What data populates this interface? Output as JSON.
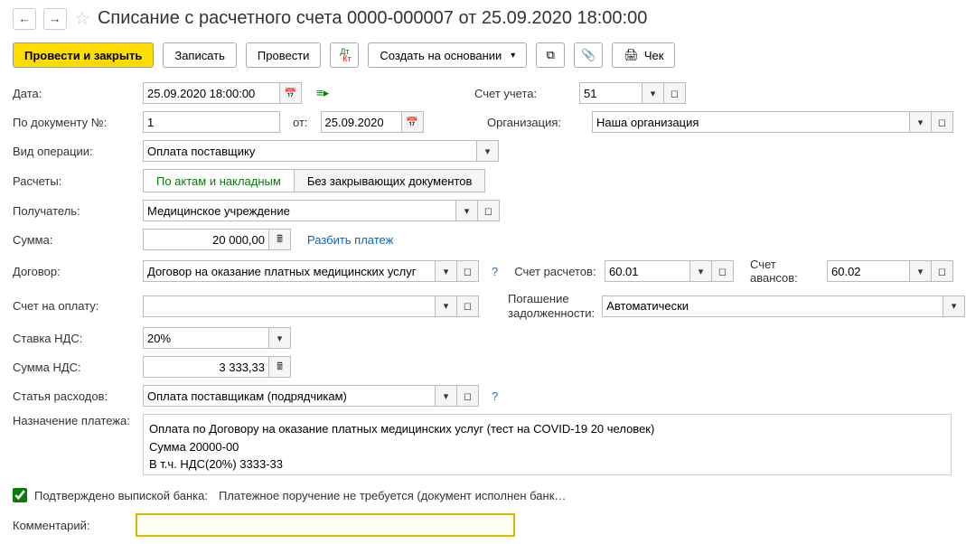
{
  "header": {
    "title": "Списание с расчетного счета 0000-000007 от 25.09.2020 18:00:00"
  },
  "toolbar": {
    "post_and_close": "Провести и закрыть",
    "write": "Записать",
    "post": "Провести",
    "create_based_on": "Создать на основании",
    "check": "Чек"
  },
  "fields": {
    "date_lbl": "Дата:",
    "date_val": "25.09.2020 18:00:00",
    "doc_num_lbl": "По документу №:",
    "doc_num_val": "1",
    "from_lbl": "от:",
    "from_val": "25.09.2020",
    "op_type_lbl": "Вид операции:",
    "op_type_val": "Оплата поставщику",
    "calc_lbl": "Расчеты:",
    "tab_acts": "По актам и накладным",
    "tab_nodocs": "Без закрывающих документов",
    "recipient_lbl": "Получатель:",
    "recipient_val": "Медицинское учреждение",
    "sum_lbl": "Сумма:",
    "sum_val": "20 000,00",
    "split_payment": "Разбить платеж",
    "contract_lbl": "Договор:",
    "contract_val": "Договор на оказание платных медицинских услуг",
    "invoice_lbl": "Счет на оплату:",
    "invoice_val": "",
    "vat_rate_lbl": "Ставка НДС:",
    "vat_rate_val": "20%",
    "vat_sum_lbl": "Сумма НДС:",
    "vat_sum_val": "3 333,33",
    "expense_lbl": "Статья расходов:",
    "expense_val": "Оплата поставщикам (подрядчикам)",
    "purpose_lbl": "Назначение платежа:",
    "purpose_val": "Оплата по Договору на оказание платных медицинских услуг (тест на COVID-19 20 человек)\nСумма 20000-00\nВ т.ч. НДС(20%) 3333-33",
    "account_lbl": "Счет учета:",
    "account_val": "51",
    "org_lbl": "Организация:",
    "org_val": "Наша организация",
    "settlement_acc_lbl": "Счет расчетов:",
    "settlement_acc_val": "60.01",
    "advance_acc_lbl": "Счет авансов:",
    "advance_acc_val": "60.02",
    "debt_lbl": "Погашение задолженности:",
    "debt_val": "Автоматически",
    "confirmed_lbl": "Подтверждено выпиской банка:",
    "confirmed_text": "Платежное поручение не требуется (документ исполнен банк…",
    "comment_lbl": "Комментарий:",
    "comment_val": ""
  }
}
